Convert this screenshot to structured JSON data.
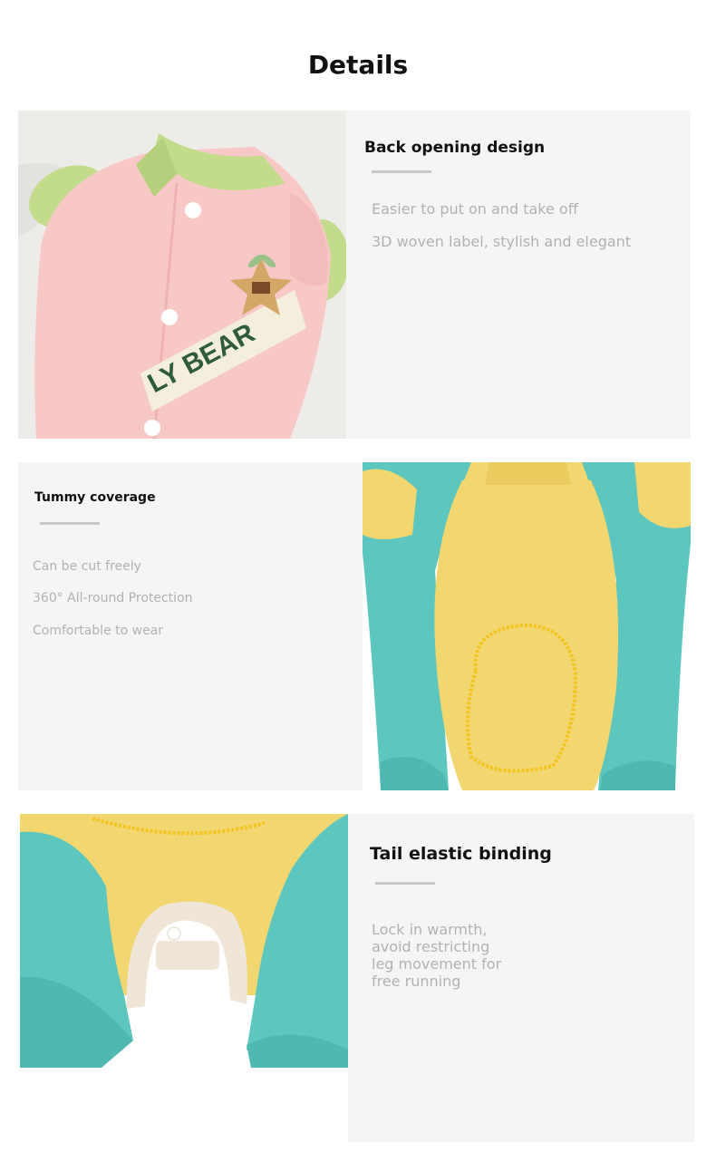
{
  "page": {
    "title": "Details"
  },
  "sections": [
    {
      "heading": "Back opening design",
      "features": [
        "Easier to put on and take off",
        "3D woven label, stylish and elegant"
      ],
      "photo_label_text": "LY BEAR",
      "colors": {
        "body": "#f7c8c6",
        "trim": "#c3dc8c",
        "label": "#f4efdc",
        "lettering": "#2f5d3a"
      }
    },
    {
      "heading": "Tummy coverage",
      "features": [
        "Can be cut freely",
        "360° All-round Protection",
        "Comfortable to wear"
      ],
      "colors": {
        "sides": "#5dc7bf",
        "belly": "#f2d670",
        "stitch": "#f3c41e"
      }
    },
    {
      "heading": "Tail elastic binding",
      "features": [
        "Lock in warmth,",
        "avoid restricting",
        "leg movement for",
        "free running"
      ],
      "colors": {
        "sides": "#5dc7bf",
        "belly": "#f2d670",
        "binding": "#efe6d8"
      }
    }
  ]
}
